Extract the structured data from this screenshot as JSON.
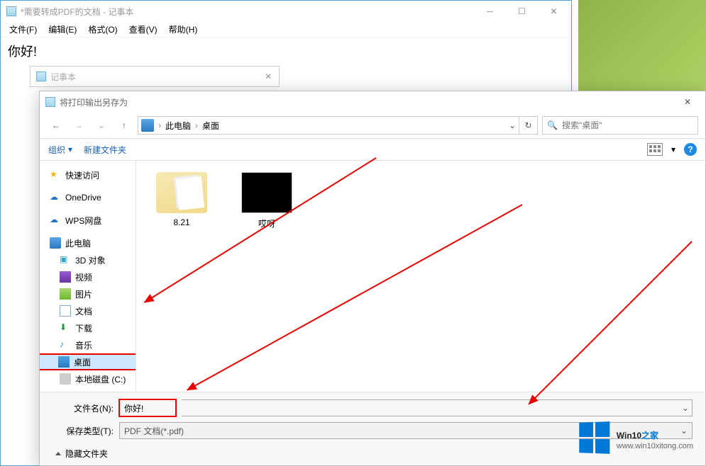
{
  "notepad": {
    "title": "*需要转成PDF的文档 - 记事本",
    "menu": {
      "file": "文件(F)",
      "edit": "编辑(E)",
      "format": "格式(O)",
      "view": "查看(V)",
      "help": "帮助(H)"
    },
    "content": "你好!"
  },
  "mini_dialog": {
    "title": "记事本"
  },
  "saveas": {
    "title": "将打印输出另存为",
    "breadcrumb": {
      "root": "此电脑",
      "current": "桌面"
    },
    "search": {
      "placeholder": "搜索\"桌面\""
    },
    "toolbar": {
      "organize": "组织",
      "newfolder": "新建文件夹"
    },
    "tree": {
      "quick": "快速访问",
      "onedrive": "OneDrive",
      "wps": "WPS网盘",
      "thispc": "此电脑",
      "objects3d": "3D 对象",
      "videos": "视频",
      "pictures": "图片",
      "documents": "文档",
      "downloads": "下载",
      "music": "音乐",
      "desktop": "桌面",
      "localdisk": "本地磁盘 (C:)"
    },
    "files": {
      "item0": "8.21",
      "item1": "哎呀"
    },
    "footer": {
      "filename_label": "文件名(N):",
      "filename_value": "你好!",
      "type_label": "保存类型(T):",
      "type_value": "PDF 文档(*.pdf)",
      "hide": "隐藏文件夹"
    }
  },
  "watermark": {
    "brand_a": "Win10",
    "brand_b": "之家",
    "url": "www.win10xitong.com"
  }
}
